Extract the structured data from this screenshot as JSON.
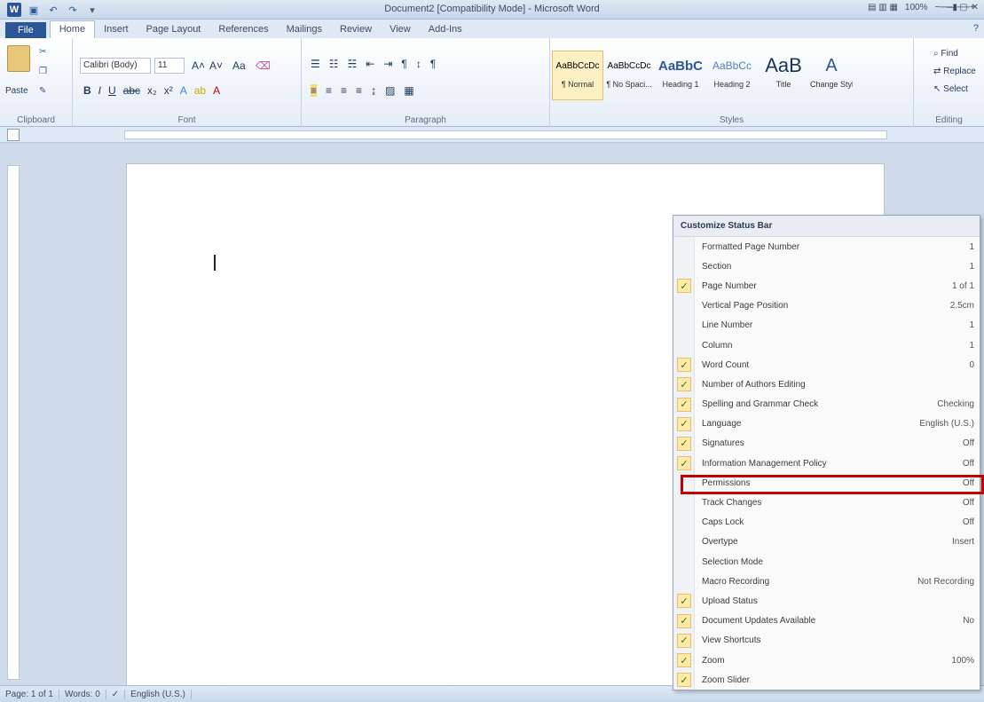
{
  "window": {
    "title": "Document2 [Compatibility Mode] - Microsoft Word",
    "help": "?"
  },
  "tabs": [
    "File",
    "Home",
    "Insert",
    "Page Layout",
    "References",
    "Mailings",
    "Review",
    "View",
    "Add-Ins"
  ],
  "ribbon": {
    "clipboard": {
      "label": "Clipboard",
      "paste": "Paste"
    },
    "font": {
      "label": "Font",
      "name": "Calibri (Body)",
      "size": "11"
    },
    "paragraph": {
      "label": "Paragraph"
    },
    "styles": {
      "label": "Styles",
      "tiles": [
        {
          "sample": "AaBbCcDc",
          "name": "¶ Normal"
        },
        {
          "sample": "AaBbCcDc",
          "name": "¶ No Spaci..."
        },
        {
          "sample": "AaBbC",
          "name": "Heading 1"
        },
        {
          "sample": "AaBbCc",
          "name": "Heading 2"
        },
        {
          "sample": "AaB",
          "name": "Title"
        }
      ],
      "change": "Change Styles"
    },
    "editing": {
      "label": "Editing",
      "find": "Find",
      "replace": "Replace",
      "select": "Select"
    }
  },
  "statusbar": {
    "page": "Page: 1 of 1",
    "words": "Words: 0",
    "language": "English (U.S.)",
    "zoom": "100%"
  },
  "context_menu": {
    "title": "Customize Status Bar",
    "items": [
      {
        "label": "Formatted Page Number",
        "value": "1",
        "checked": false
      },
      {
        "label": "Section",
        "value": "1",
        "checked": false
      },
      {
        "label": "Page Number",
        "value": "1 of 1",
        "checked": true
      },
      {
        "label": "Vertical Page Position",
        "value": "2.5cm",
        "checked": false
      },
      {
        "label": "Line Number",
        "value": "1",
        "checked": false
      },
      {
        "label": "Column",
        "value": "1",
        "checked": false
      },
      {
        "label": "Word Count",
        "value": "0",
        "checked": true
      },
      {
        "label": "Number of Authors Editing",
        "value": "",
        "checked": true
      },
      {
        "label": "Spelling and Grammar Check",
        "value": "Checking",
        "checked": true
      },
      {
        "label": "Language",
        "value": "English (U.S.)",
        "checked": true
      },
      {
        "label": "Signatures",
        "value": "Off",
        "checked": true
      },
      {
        "label": "Information Management Policy",
        "value": "Off",
        "checked": true
      },
      {
        "label": "Permissions",
        "value": "Off",
        "checked": false
      },
      {
        "label": "Track Changes",
        "value": "Off",
        "checked": false
      },
      {
        "label": "Caps Lock",
        "value": "Off",
        "checked": false
      },
      {
        "label": "Overtype",
        "value": "Insert",
        "checked": false
      },
      {
        "label": "Selection Mode",
        "value": "",
        "checked": false
      },
      {
        "label": "Macro Recording",
        "value": "Not Recording",
        "checked": false
      },
      {
        "label": "Upload Status",
        "value": "",
        "checked": true
      },
      {
        "label": "Document Updates Available",
        "value": "No",
        "checked": true
      },
      {
        "label": "View Shortcuts",
        "value": "",
        "checked": true
      },
      {
        "label": "Zoom",
        "value": "100%",
        "checked": true
      },
      {
        "label": "Zoom Slider",
        "value": "",
        "checked": true
      }
    ]
  },
  "colors": {
    "accent": "#2b579a",
    "highlight": "#c00000"
  }
}
